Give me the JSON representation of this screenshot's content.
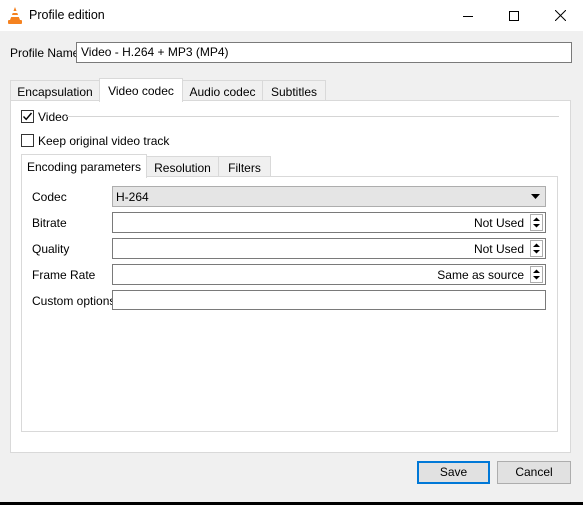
{
  "window": {
    "title": "Profile edition",
    "icon": "vlc-cone-icon",
    "controls": [
      "minimize-icon",
      "maximize-icon",
      "close-icon"
    ]
  },
  "profile": {
    "label": "Profile Name",
    "value": "Video - H.264 + MP3 (MP4)"
  },
  "tabs": [
    {
      "label": "Encapsulation",
      "active": false
    },
    {
      "label": "Video codec",
      "active": true
    },
    {
      "label": "Audio codec",
      "active": false
    },
    {
      "label": "Subtitles",
      "active": false
    }
  ],
  "video_codec": {
    "video_checkbox": {
      "label": "Video",
      "checked": true
    },
    "keep_original": {
      "label": "Keep original video track",
      "checked": false
    },
    "subtabs": [
      {
        "label": "Encoding parameters",
        "active": true
      },
      {
        "label": "Resolution",
        "active": false
      },
      {
        "label": "Filters",
        "active": false
      }
    ],
    "fields": {
      "codec": {
        "label": "Codec",
        "value": "H-264"
      },
      "bitrate": {
        "label": "Bitrate",
        "value": "Not Used"
      },
      "quality": {
        "label": "Quality",
        "value": "Not Used"
      },
      "frame_rate": {
        "label": "Frame Rate",
        "value": "Same as source"
      },
      "custom_options": {
        "label": "Custom options",
        "value": ""
      }
    }
  },
  "buttons": {
    "save": "Save",
    "cancel": "Cancel"
  },
  "colors": {
    "accent": "#0078d7",
    "window_bg": "#f0f0f0",
    "vlc_orange": "#f58220"
  }
}
